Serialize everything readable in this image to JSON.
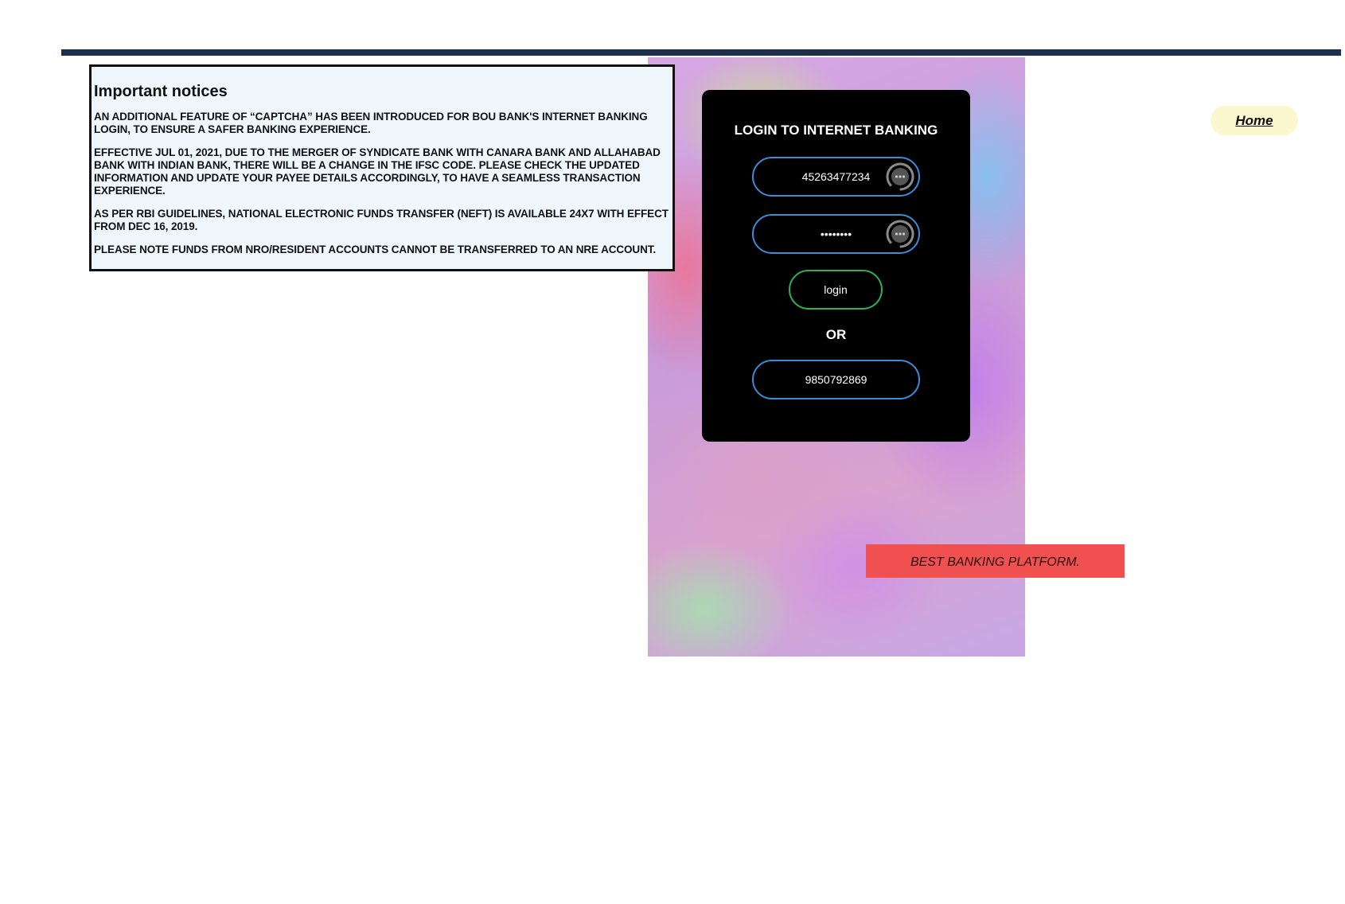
{
  "notices": {
    "title": "Important notices",
    "items": [
      "AN ADDITIONAL FEATURE OF “CAPTCHA” HAS BEEN INTRODUCED FOR BOU BANK'S INTERNET BANKING LOGIN, TO ENSURE A SAFER BANKING EXPERIENCE.",
      "EFFECTIVE JUL 01, 2021, DUE TO THE MERGER OF SYNDICATE BANK WITH CANARA BANK AND ALLAHABAD BANK WITH INDIAN BANK, THERE WILL BE A CHANGE IN THE IFSC CODE. PLEASE CHECK THE UPDATED INFORMATION AND UPDATE YOUR PAYEE DETAILS ACCORDINGLY, TO HAVE A SEAMLESS TRANSACTION EXPERIENCE.",
      "AS PER RBI GUIDELINES, NATIONAL ELECTRONIC FUNDS TRANSFER (NEFT) IS AVAILABLE 24X7 WITH EFFECT FROM DEC 16, 2019.",
      "PLEASE NOTE FUNDS FROM NRO/RESIDENT ACCOUNTS CANNOT BE TRANSFERRED TO AN NRE ACCOUNT."
    ]
  },
  "login": {
    "title": "LOGIN TO INTERNET BANKING",
    "user_id_value": "45263477234",
    "password_value": "••••••••",
    "login_button": "login",
    "or_label": "OR",
    "mobile_value": "9850792869",
    "field_icon": "password-manager-icon"
  },
  "banner": {
    "text": "BEST BANKING PLATFORM."
  },
  "nav": {
    "home": "Home"
  },
  "colors": {
    "top_bar": "#1e2f4d",
    "input_border": "#3a8bd8",
    "login_border": "#2fb14f",
    "banner_bg": "#f05050",
    "home_bg": "#fbf7cf"
  }
}
